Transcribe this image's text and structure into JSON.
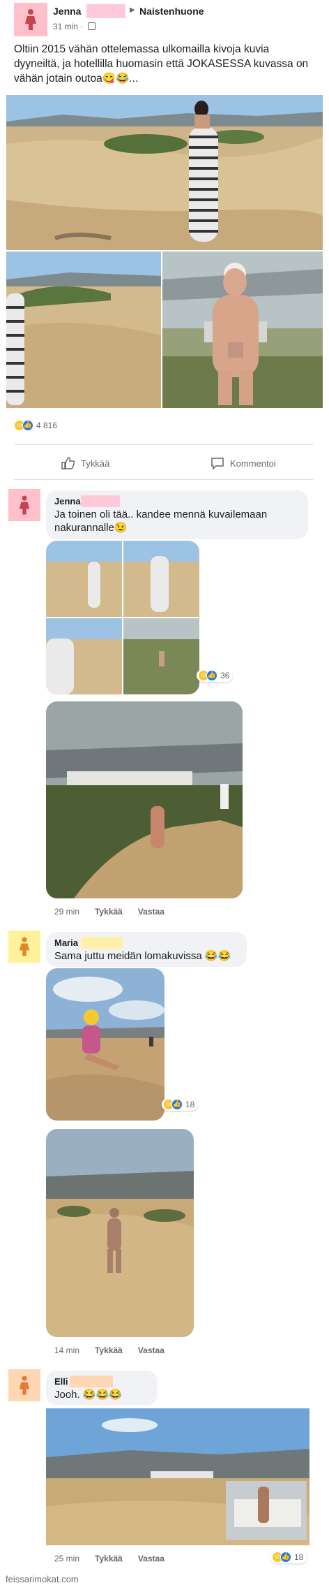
{
  "post": {
    "author": "Jenna",
    "arrow": "▶",
    "group": "Naistenhuone",
    "time": "31 min ·",
    "text": "Oltiin 2015 vähän ottelemassa ulkomailla kivoja kuvia dyyneiltä, ja hotellilla huomasin että JOKASESSA kuvassa on vähän jotain outoa😋😂...",
    "reaction_count": "4 816",
    "like_label": "Tykkää",
    "comment_label": "Kommentoi"
  },
  "comments": [
    {
      "author": "Jenna",
      "text": "Ja toinen oli tää.. kandee mennä kuvailemaan nakurannalle😉",
      "collage_reactions": "36",
      "time": "29 min",
      "like": "Tykkää",
      "reply": "Vastaa"
    },
    {
      "author": "Maria",
      "text": "Sama juttu meidän lomakuvissa 😂😂",
      "image_reactions": "18",
      "time": "14 min",
      "like": "Tykkää",
      "reply": "Vastaa"
    },
    {
      "author": "Elli",
      "text": "Jooh. 😂😂😂",
      "time": "25 min",
      "like": "Tykkää",
      "reply": "Vastaa",
      "reactions": "18"
    }
  ],
  "watermark": "feissarimokat.com",
  "colors": {
    "redact_pink": "#ffc9d9",
    "redact_yellow": "#fff2a8",
    "avatar_pink": "#ffc0cb",
    "avatar_yellow": "#fff29a",
    "avatar_peach": "#ffd7b5",
    "like_blue": "#1877f2",
    "haha_yellow": "#f7c931"
  }
}
